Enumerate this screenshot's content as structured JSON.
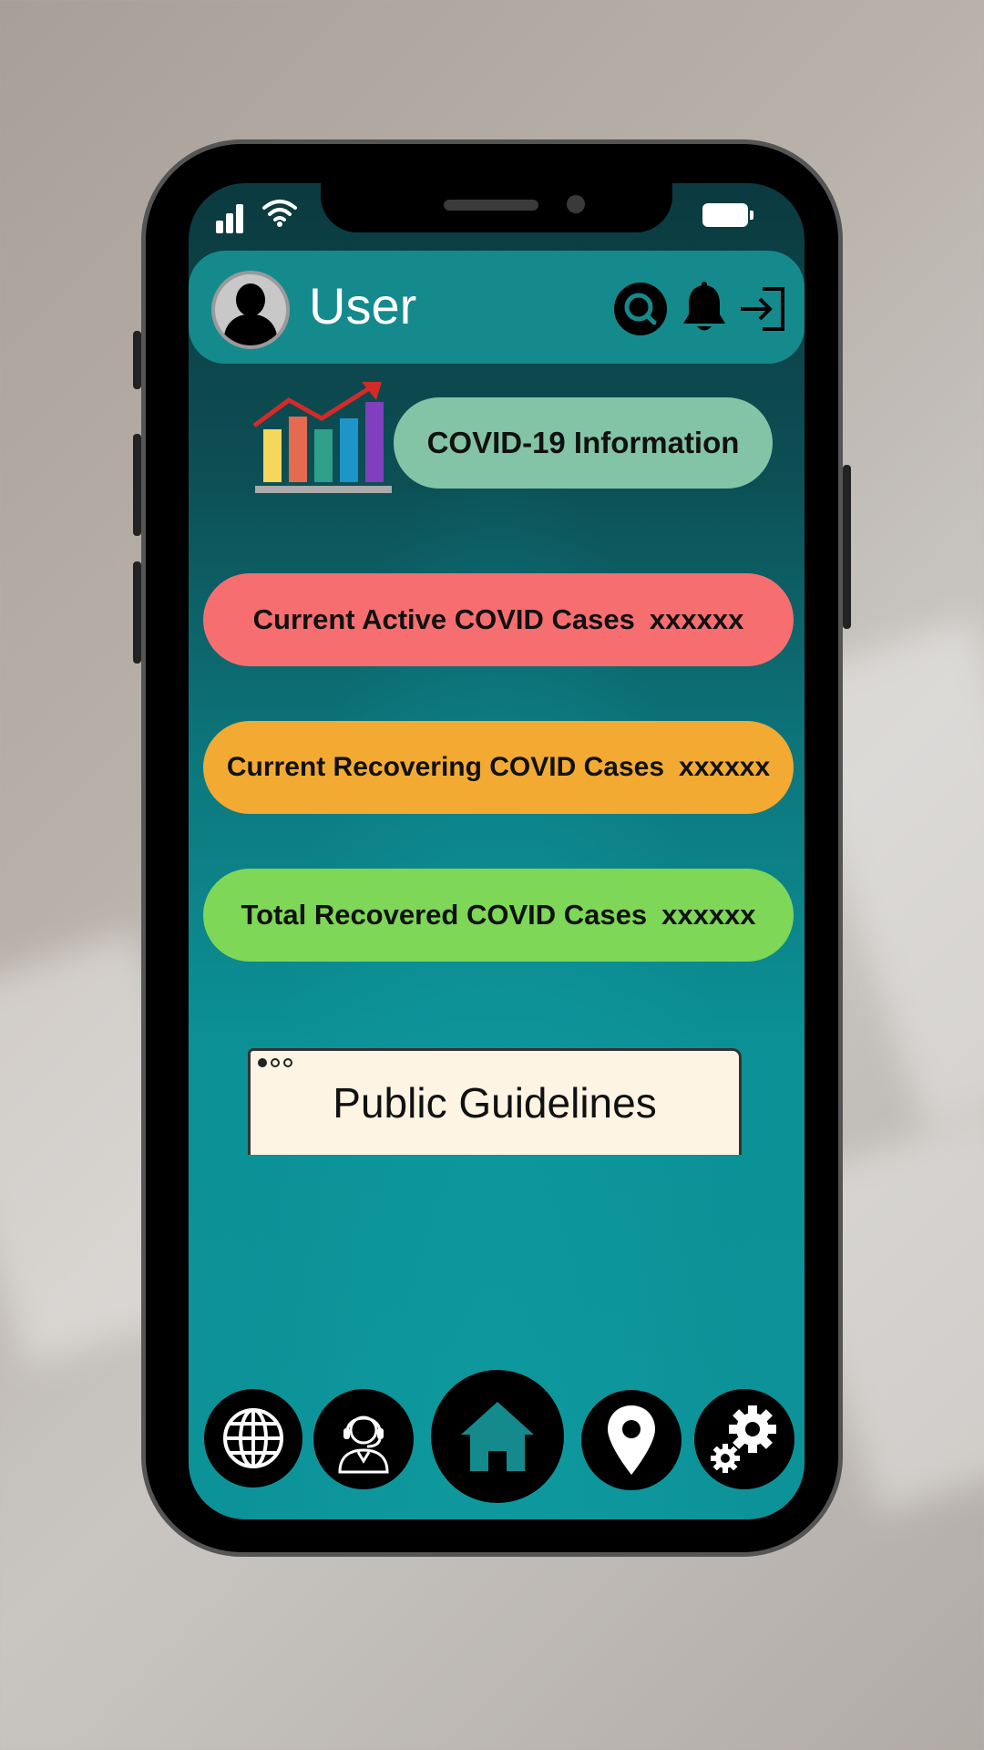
{
  "header": {
    "username": "User",
    "icons": [
      "user-avatar-icon",
      "search-icon",
      "bell-icon",
      "logout-icon"
    ]
  },
  "covid_info": {
    "label": "COVID-19 Information",
    "chart_icon": "bar-chart-trend-icon"
  },
  "stats": [
    {
      "label": "Current Active COVID Cases",
      "value": "xxxxxx",
      "color": "#f76e70"
    },
    {
      "label": "Current Recovering COVID Cases",
      "value": "xxxxxx",
      "color": "#f2aa32"
    },
    {
      "label": "Total Recovered COVID Cases",
      "value": "xxxxxx",
      "color": "#7ed757"
    }
  ],
  "guidelines": {
    "label": "Public Guidelines"
  },
  "bottom_nav": [
    "globe-icon",
    "support-agent-icon",
    "home-icon",
    "location-pin-icon",
    "settings-icon"
  ],
  "colors": {
    "topbar": "#158a8d",
    "covid_pill": "#84c4a6"
  }
}
